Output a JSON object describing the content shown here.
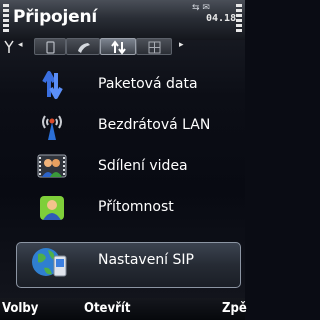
{
  "title_bar": {
    "title": "Připojení",
    "status_icons": "⇆ ✉",
    "clock": "04.18"
  },
  "tabs": {
    "nav_left": "◂",
    "nav_right": "▸",
    "items": [
      {
        "icon": "phone-outline-icon"
      },
      {
        "icon": "handset-icon"
      },
      {
        "icon": "data-arrows-icon",
        "active": true
      },
      {
        "icon": "grid-icon"
      }
    ]
  },
  "menu": {
    "items": [
      {
        "label": "Paketová data",
        "icon": "packet-data-icon"
      },
      {
        "label": "Bezdrátová LAN",
        "icon": "wlan-antenna-icon"
      },
      {
        "label": "Sdílení videa",
        "icon": "video-sharing-icon"
      },
      {
        "label": "Přítomnost",
        "icon": "presence-icon"
      },
      {
        "label": "Nastavení SIP",
        "icon": "sip-globe-icon",
        "selected": true
      }
    ]
  },
  "softkeys": {
    "left": "Volby",
    "middle": "Otevřít",
    "right": "Zpě"
  },
  "colors": {
    "background": "#0a0c14",
    "text": "#ffffff",
    "selection_border": "#8c95a3"
  }
}
